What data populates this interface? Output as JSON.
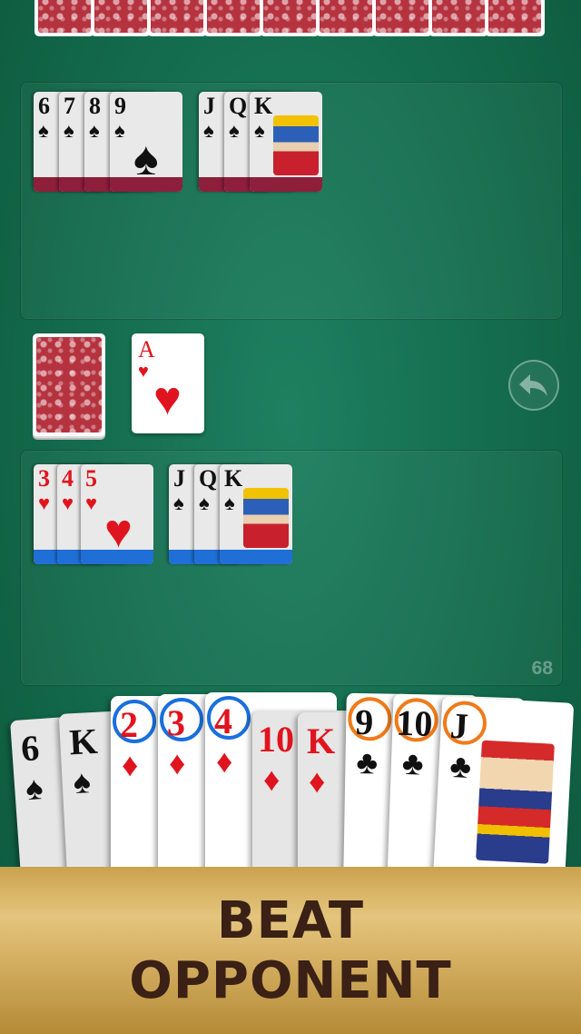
{
  "opponent_meld": {
    "run_spades": [
      "6",
      "7",
      "8",
      "9"
    ],
    "set_spades": [
      "J",
      "Q",
      "K"
    ],
    "suit": "♠",
    "bar_color": "#8e1f3a"
  },
  "deck": {
    "discard_rank": "A",
    "discard_suit": "♥"
  },
  "player_meld": {
    "run_hearts": [
      "3",
      "4",
      "5"
    ],
    "set_spades": [
      "J",
      "Q",
      "K"
    ],
    "heart": "♥",
    "spade": "♠",
    "bar_color": "#1f6fd6",
    "score": "68"
  },
  "hand": {
    "cards": [
      {
        "rank": "6",
        "suit": "♠"
      },
      {
        "rank": "K",
        "suit": "♠"
      },
      {
        "rank": "2",
        "suit": "♦"
      },
      {
        "rank": "3",
        "suit": "♦"
      },
      {
        "rank": "4",
        "suit": "♦"
      },
      {
        "rank": "10",
        "suit": "♦"
      },
      {
        "rank": "K",
        "suit": "♦"
      },
      {
        "rank": "9",
        "suit": "♣"
      },
      {
        "rank": "10",
        "suit": "♣"
      },
      {
        "rank": "J",
        "suit": "♣"
      }
    ]
  },
  "icons": {
    "undo": "undo-arrow-icon"
  },
  "banner": {
    "line1": "BEAT",
    "line2": "OPPONENT"
  }
}
